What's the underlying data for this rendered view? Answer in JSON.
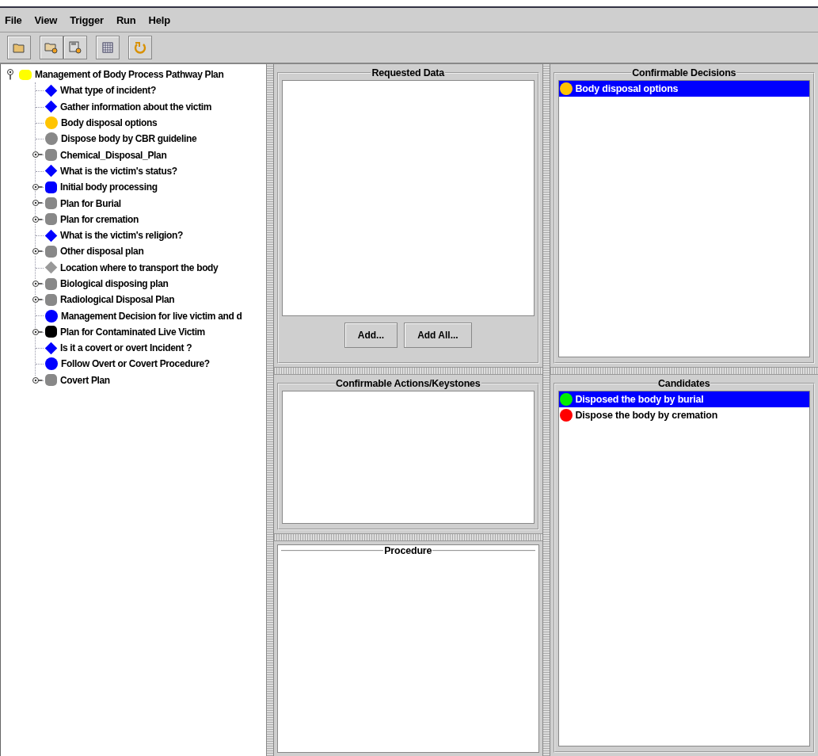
{
  "menu": [
    "File",
    "View",
    "Trigger",
    "Run",
    "Help"
  ],
  "tree": {
    "label": "Management of Body Process Pathway Plan",
    "kind": "bar",
    "color": "#ffff00",
    "expanded": true,
    "children": [
      {
        "label": "What type of incident?",
        "kind": "diamond",
        "color": "#0000ff"
      },
      {
        "label": "Gather information about the victim",
        "kind": "diamond",
        "color": "#0000ff"
      },
      {
        "label": "Body disposal options",
        "kind": "circle",
        "color": "#ffc400"
      },
      {
        "label": "Dispose  body by CBR guideline",
        "kind": "circle",
        "color": "#888888"
      },
      {
        "label": "Chemical_Disposal_Plan",
        "kind": "square",
        "color": "#888888",
        "expanded": false
      },
      {
        "label": "What is the victim's status?",
        "kind": "diamond",
        "color": "#0000ff"
      },
      {
        "label": "Initial body processing",
        "kind": "square",
        "color": "#0000ff",
        "expanded": false
      },
      {
        "label": "Plan for Burial",
        "kind": "square",
        "color": "#888888",
        "expanded": false
      },
      {
        "label": "Plan for cremation",
        "kind": "square",
        "color": "#888888",
        "expanded": false
      },
      {
        "label": "What is the victim's religion?",
        "kind": "diamond",
        "color": "#0000ff"
      },
      {
        "label": "Other disposal plan",
        "kind": "square",
        "color": "#888888",
        "expanded": false
      },
      {
        "label": "Location where to transport the body",
        "kind": "diamond",
        "color": "#999999"
      },
      {
        "label": "Biological disposing plan",
        "kind": "square",
        "color": "#888888",
        "expanded": false
      },
      {
        "label": "Radiological Disposal Plan",
        "kind": "square",
        "color": "#888888",
        "expanded": false
      },
      {
        "label": "Management Decision for live victim and d",
        "kind": "circle",
        "color": "#0000ff"
      },
      {
        "label": "Plan for Contaminated Live Victim",
        "kind": "square",
        "color": "#000000",
        "expanded": false
      },
      {
        "label": "Is it a covert or overt Incident ?",
        "kind": "diamond",
        "color": "#0000ff"
      },
      {
        "label": "Follow Overt or Covert Procedure?",
        "kind": "circle",
        "color": "#0000ff"
      },
      {
        "label": "Covert Plan",
        "kind": "square",
        "color": "#888888",
        "expanded": false
      }
    ]
  },
  "requested_data": {
    "title": "Requested Data",
    "buttons": [
      "Add...",
      "Add All..."
    ]
  },
  "actions": {
    "title": "Confirmable Actions/Keystones"
  },
  "procedure": {
    "title": "Procedure"
  },
  "decisions": {
    "title": "Confirmable Decisions",
    "items": [
      {
        "label": "Body disposal options",
        "color": "#ffc400",
        "selected": true
      }
    ]
  },
  "candidates": {
    "title": "Candidates",
    "items": [
      {
        "label": "Disposed the body by burial",
        "color": "#00ee00",
        "selected": true
      },
      {
        "label": "Dispose the body by cremation",
        "color": "#ff0000",
        "selected": false
      }
    ]
  }
}
